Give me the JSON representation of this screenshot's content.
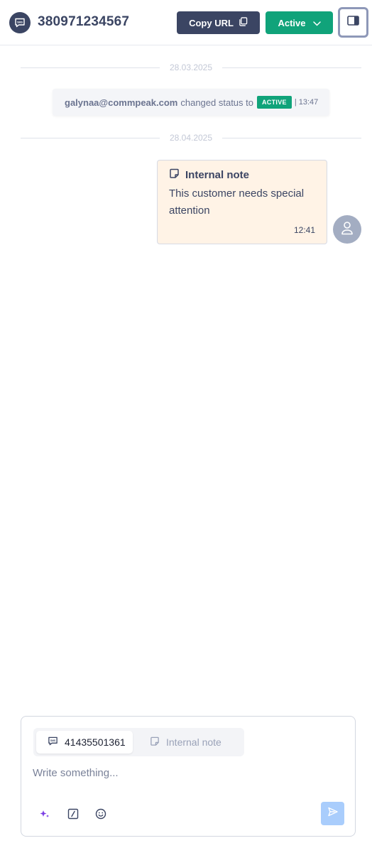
{
  "header": {
    "title": "380971234567",
    "channel_icon": "sms-chat-icon",
    "copy_url_label": "Copy URL",
    "status_label": "Active",
    "panel_toggle_icon": "side-panel-icon"
  },
  "timeline": {
    "dates": [
      "28.03.2025",
      "28.04.2025"
    ],
    "status_event": {
      "user": "galynaa@commpeak.com",
      "text": "changed status to",
      "status": "ACTIVE",
      "time": "| 13:47"
    },
    "note": {
      "title": "Internal note",
      "body": "This customer needs special attention",
      "time": "12:41"
    }
  },
  "composer": {
    "tabs": [
      {
        "label": "41435501361",
        "icon": "sms-icon",
        "active": true
      },
      {
        "label": "Internal note",
        "icon": "note-icon",
        "active": false
      }
    ],
    "placeholder": "Write something...",
    "tools": [
      "ai-sparkle-icon",
      "slash-command-icon",
      "emoji-icon"
    ],
    "send_icon": "send-icon"
  },
  "colors": {
    "primary": "#3b4563",
    "success": "#10a37a",
    "note_bg": "#fff3e6",
    "send_disabled": "#a9cdfc"
  }
}
